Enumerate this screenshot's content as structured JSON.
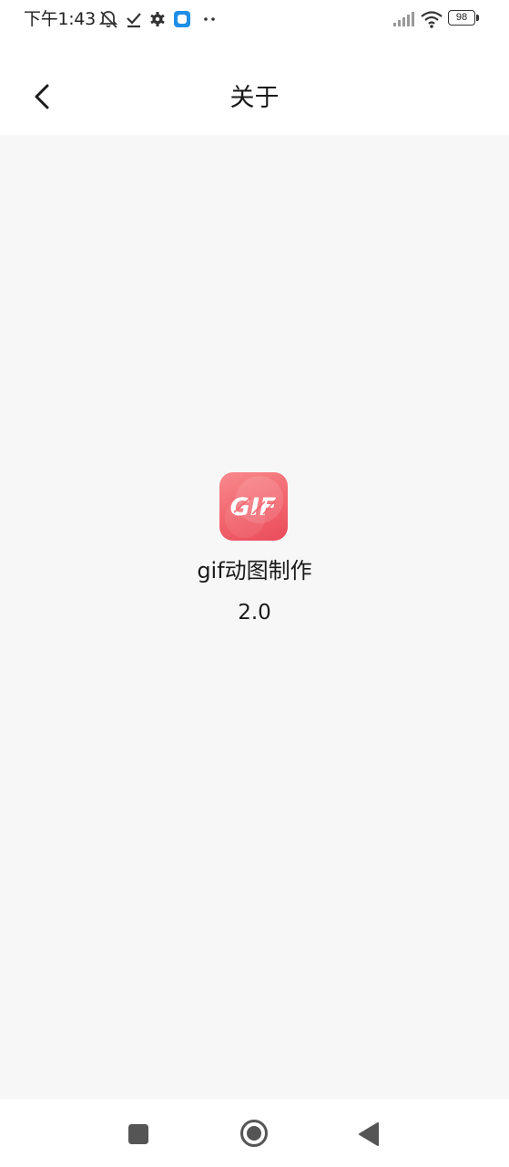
{
  "status_bar": {
    "time": "下午1:43",
    "battery": "98",
    "icons": [
      "mute-notification-icon",
      "check-icon",
      "gear-icon",
      "app-notification-icon",
      "more-dots-icon",
      "signal-icon",
      "wifi-icon",
      "battery-icon"
    ]
  },
  "header": {
    "title": "关于",
    "back_icon": "chevron-left-icon"
  },
  "about": {
    "logo_text": "GIF",
    "app_name": "gif动图制作",
    "version": "2.0"
  },
  "nav_bar": {
    "icons": [
      "recents-square-icon",
      "home-circle-icon",
      "back-triangle-icon"
    ]
  },
  "colors": {
    "content_background": "#f7f7f7",
    "logo_gradient_start": "#f88a8e",
    "logo_gradient_end": "#e94b5a",
    "notification_app_blue": "#1e8fe8"
  }
}
